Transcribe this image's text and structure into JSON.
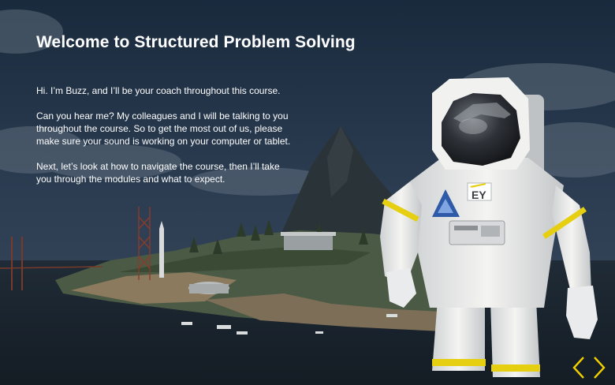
{
  "slide": {
    "title": "Welcome to Structured Problem Solving",
    "paragraphs": [
      "Hi. I’m Buzz, and I’ll be your coach throughout this course.",
      "Can you hear me? My colleagues and I will be talking to you throughout the course. So to get the most out of us, please make sure your sound is working on your computer or tablet.",
      "Next, let’s look at how to navigate the course, then I’ll take you through the modules and what to expect."
    ]
  },
  "character": {
    "patch_text": "EY"
  },
  "navigation": {
    "prev_icon": "chevron-left-icon",
    "next_icon": "chevron-right-icon",
    "accent_color": "#f2d000"
  },
  "colors": {
    "accent": "#f2d000",
    "text": "#ffffff"
  }
}
